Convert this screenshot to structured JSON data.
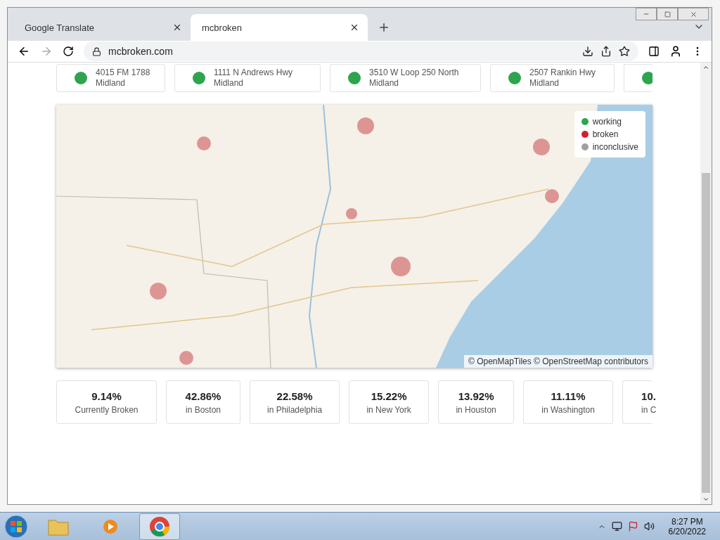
{
  "browser": {
    "tabs": [
      {
        "title": "Google Translate",
        "selected": false
      },
      {
        "title": "mcbroken",
        "selected": true
      }
    ],
    "address": "mcbroken.com"
  },
  "locations": [
    {
      "address": "4015 FM 1788",
      "city": "Midland",
      "color": "#2ea44f"
    },
    {
      "address": "1111 N Andrews Hwy",
      "city": "Midland",
      "color": "#2ea44f"
    },
    {
      "address": "3510 W Loop 250 North",
      "city": "Midland",
      "color": "#2ea44f"
    },
    {
      "address": "2507 Rankin Hwy",
      "city": "Midland",
      "color": "#2ea44f"
    },
    {
      "color": "#2ea44f"
    }
  ],
  "map": {
    "legend": [
      {
        "label": "working",
        "color": "#2ea44f"
      },
      {
        "label": "broken",
        "color": "#d0202e"
      },
      {
        "label": "inconclusive",
        "color": "#a0a0a0"
      }
    ],
    "attribution": "© OpenMapTiles © OpenStreetMap contributors"
  },
  "stats": [
    {
      "value": "9.14%",
      "label": "Currently Broken"
    },
    {
      "value": "42.86%",
      "label": "in Boston"
    },
    {
      "value": "22.58%",
      "label": "in Philadelphia"
    },
    {
      "value": "15.22%",
      "label": "in New York"
    },
    {
      "value": "13.92%",
      "label": "in Houston"
    },
    {
      "value": "11.11%",
      "label": "in Washington"
    },
    {
      "value": "10.",
      "label": "in C"
    }
  ],
  "taskbar": {
    "time": "8:27 PM",
    "date": "6/20/2022"
  }
}
